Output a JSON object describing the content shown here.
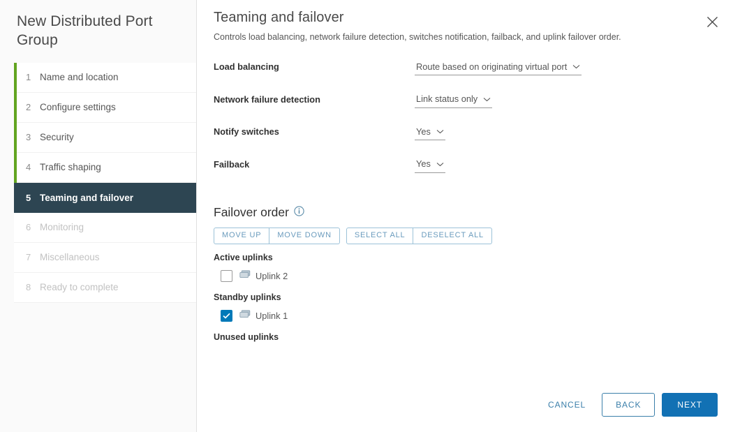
{
  "wizard": {
    "title": "New Distributed Port Group",
    "progress_color": "#62a420",
    "active_step_color": "#2d4552",
    "steps": [
      {
        "num": "1",
        "label": "Name and location",
        "state": "complete"
      },
      {
        "num": "2",
        "label": "Configure settings",
        "state": "complete"
      },
      {
        "num": "3",
        "label": "Security",
        "state": "complete"
      },
      {
        "num": "4",
        "label": "Traffic shaping",
        "state": "complete"
      },
      {
        "num": "5",
        "label": "Teaming and failover",
        "state": "active"
      },
      {
        "num": "6",
        "label": "Monitoring",
        "state": "disabled"
      },
      {
        "num": "7",
        "label": "Miscellaneous",
        "state": "disabled"
      },
      {
        "num": "8",
        "label": "Ready to complete",
        "state": "disabled"
      }
    ]
  },
  "page": {
    "title": "Teaming and failover",
    "subtitle": "Controls load balancing, network failure detection, switches notification, failback, and uplink failover order.",
    "close_icon": "close-icon"
  },
  "form": {
    "load_balancing": {
      "label": "Load balancing",
      "value": "Route based on originating virtual port"
    },
    "network_failure_detection": {
      "label": "Network failure detection",
      "value": "Link status only"
    },
    "notify_switches": {
      "label": "Notify switches",
      "value": "Yes"
    },
    "failback": {
      "label": "Failback",
      "value": "Yes"
    }
  },
  "failover_order": {
    "title": "Failover order",
    "info_icon": "info-icon",
    "buttons_move": [
      {
        "label": "MOVE UP",
        "name": "move-up-button"
      },
      {
        "label": "MOVE DOWN",
        "name": "move-down-button"
      }
    ],
    "buttons_select": [
      {
        "label": "SELECT ALL",
        "name": "select-all-button"
      },
      {
        "label": "DESELECT ALL",
        "name": "deselect-all-button"
      }
    ],
    "accent_color": "#9cc2d8",
    "checkbox_checked_color": "#0079b8",
    "groups": [
      {
        "heading": "Active uplinks",
        "items": [
          {
            "label": "Uplink 2",
            "checked": false,
            "icon": "uplink-icon"
          }
        ]
      },
      {
        "heading": "Standby uplinks",
        "items": [
          {
            "label": "Uplink 1",
            "checked": true,
            "icon": "uplink-icon"
          }
        ]
      },
      {
        "heading": "Unused uplinks",
        "items": []
      }
    ]
  },
  "footer": {
    "cancel_label": "CANCEL",
    "back_label": "BACK",
    "next_label": "NEXT",
    "primary_color": "#1271b4"
  }
}
